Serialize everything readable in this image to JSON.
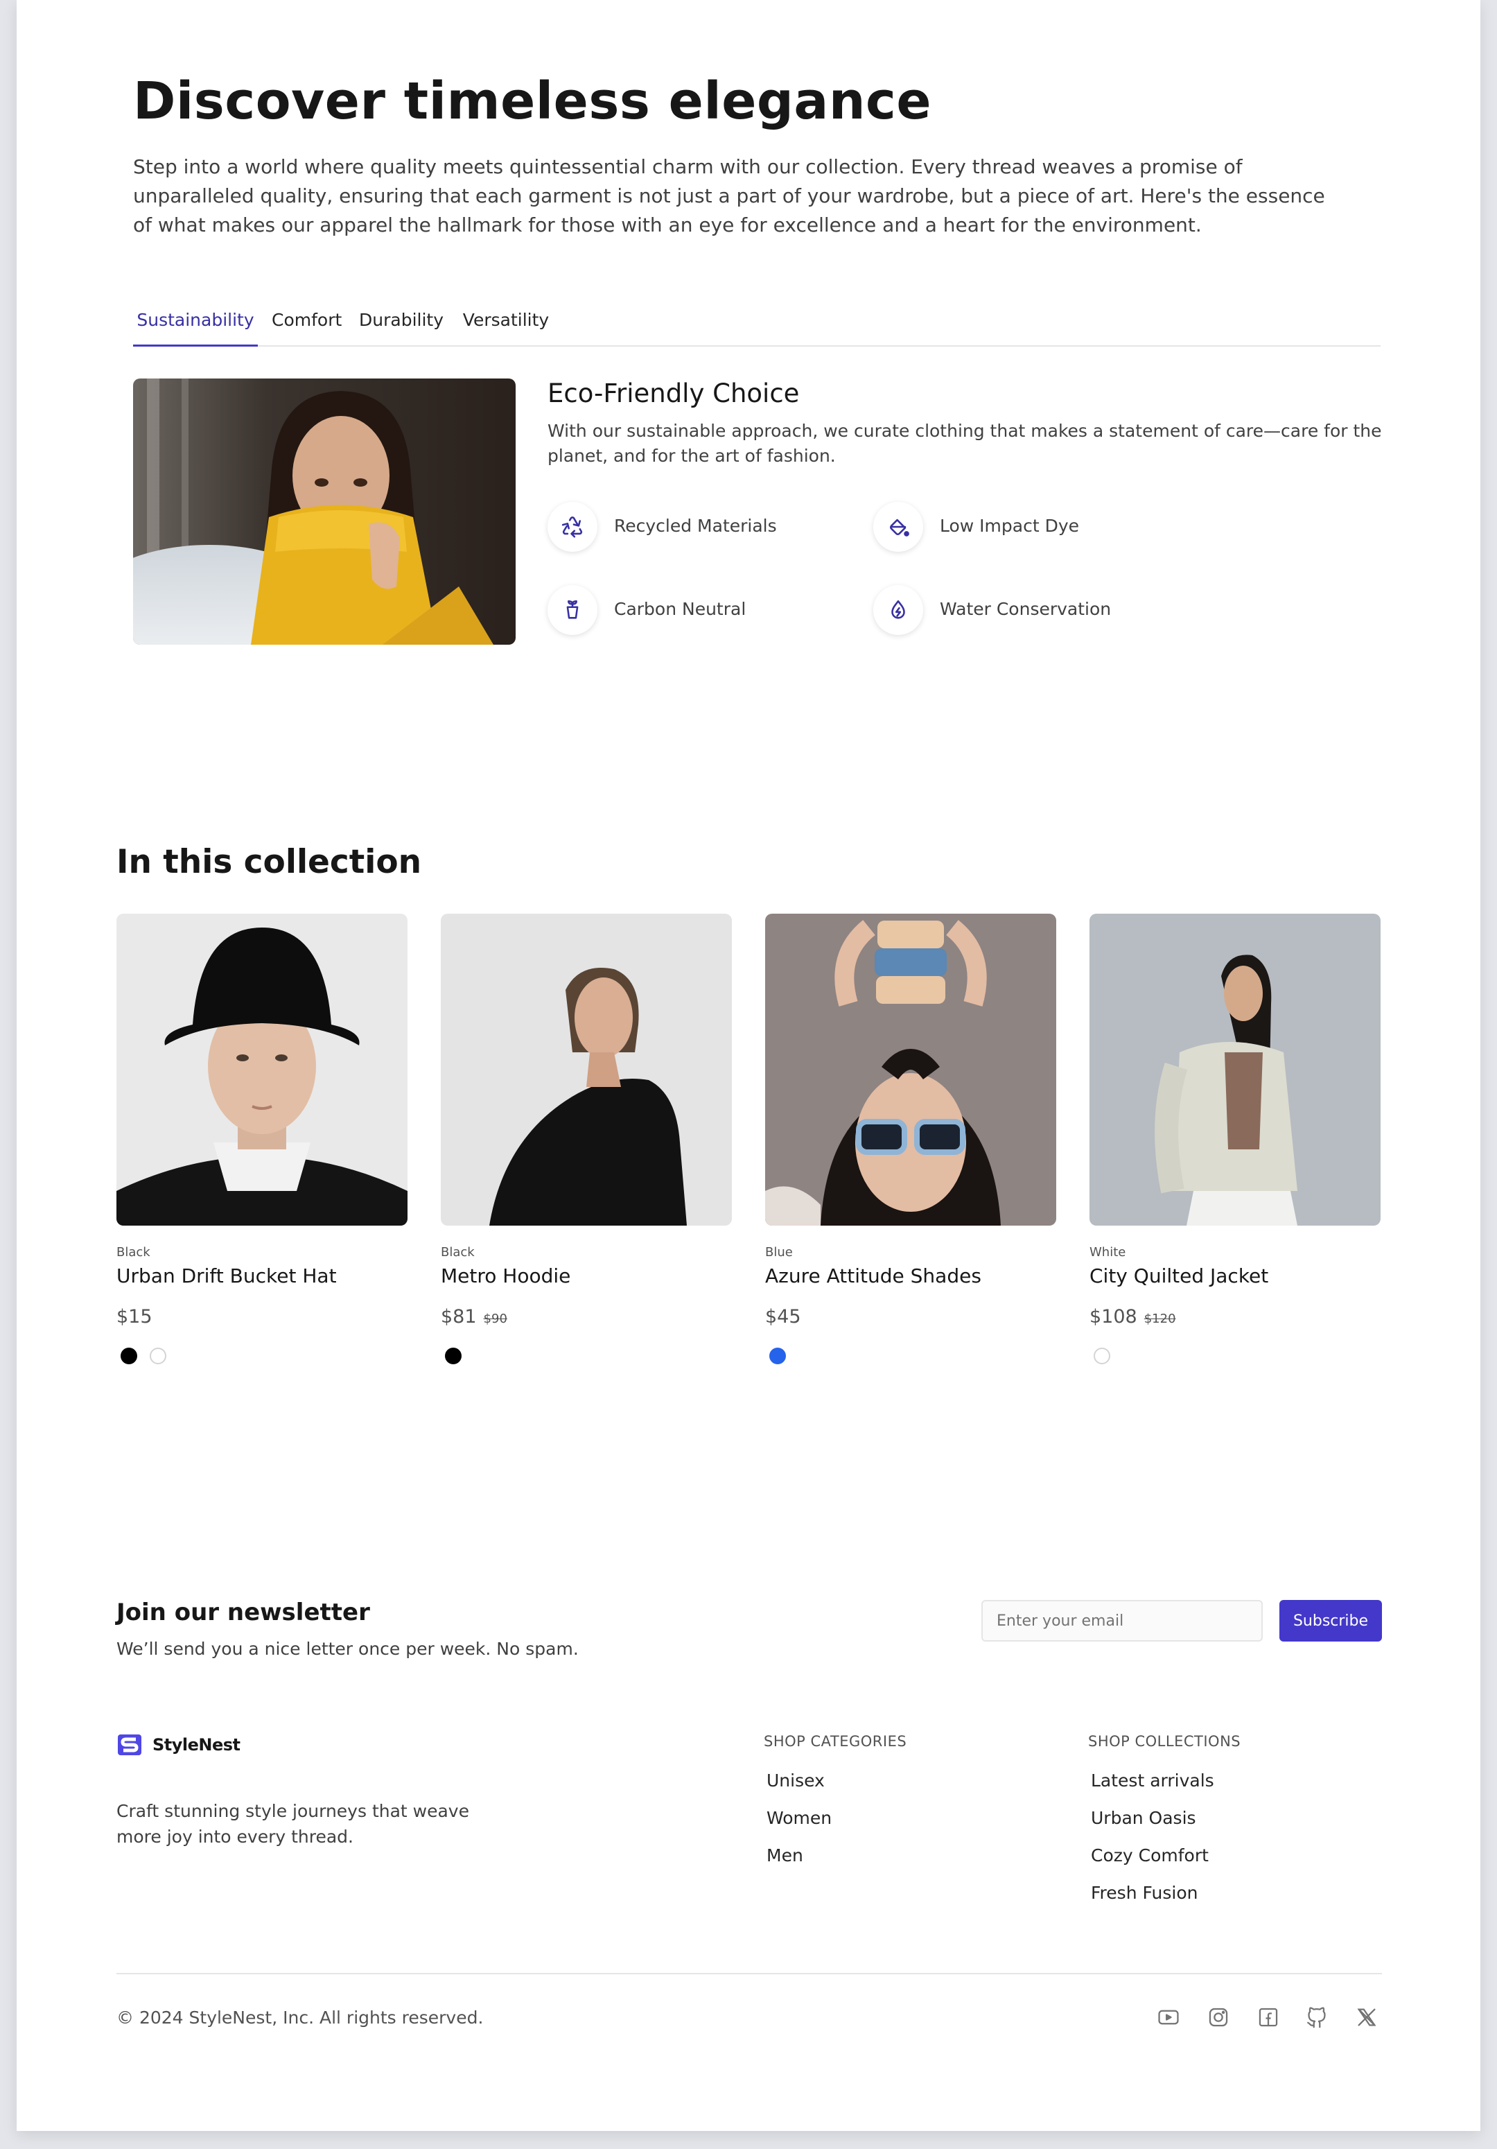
{
  "hero": {
    "title": "Discover timeless elegance",
    "description": "Step into a world where quality meets quintessential charm with our collection. Every thread weaves a promise of unparalleled quality, ensuring that each garment is not just a part of your wardrobe, but a piece of art. Here's the essence of what makes our apparel the hallmark for those with an eye for excellence and a heart for the environment."
  },
  "tabs": [
    {
      "label": "Sustainability",
      "active": true
    },
    {
      "label": "Comfort",
      "active": false
    },
    {
      "label": "Durability",
      "active": false
    },
    {
      "label": "Versatility",
      "active": false
    }
  ],
  "feature": {
    "title": "Eco-Friendly Choice",
    "description": "With our sustainable approach, we curate clothing that makes a statement of care—care for the planet, and for the art of fashion.",
    "items": [
      {
        "label": "Recycled Materials",
        "icon": "recycle-icon"
      },
      {
        "label": "Low Impact Dye",
        "icon": "paint-bucket-icon"
      },
      {
        "label": "Carbon Neutral",
        "icon": "plant-icon"
      },
      {
        "label": "Water Conservation",
        "icon": "water-drop-icon"
      }
    ]
  },
  "collection": {
    "title": "In this collection",
    "products": [
      {
        "color": "Black",
        "name": "Urban Drift Bucket Hat",
        "price": "$15",
        "old_price": "",
        "swatches": [
          "#000000",
          "#ffffff"
        ]
      },
      {
        "color": "Black",
        "name": "Metro Hoodie",
        "price": "$81",
        "old_price": "$90",
        "swatches": [
          "#000000"
        ]
      },
      {
        "color": "Blue",
        "name": "Azure Attitude Shades",
        "price": "$45",
        "old_price": "",
        "swatches": [
          "#2563eb"
        ]
      },
      {
        "color": "White",
        "name": "City Quilted Jacket",
        "price": "$108",
        "old_price": "$120",
        "swatches": [
          "#ffffff"
        ]
      }
    ]
  },
  "newsletter": {
    "title": "Join our newsletter",
    "subtitle": "We’ll send you a nice letter once per week. No spam.",
    "placeholder": "Enter your email",
    "button": "Subscribe"
  },
  "footer": {
    "brand": "StyleNest",
    "tagline": "Craft stunning style journeys that weave more joy into every thread.",
    "categories_heading": "SHOP CATEGORIES",
    "categories": [
      "Unisex",
      "Women",
      "Men"
    ],
    "collections_heading": "SHOP COLLECTIONS",
    "collections": [
      "Latest arrivals",
      "Urban Oasis",
      "Cozy Comfort",
      "Fresh Fusion"
    ],
    "copyright": "© 2024 StyleNest, Inc. All rights reserved.",
    "social": [
      "youtube-icon",
      "instagram-icon",
      "facebook-icon",
      "github-icon",
      "x-icon"
    ]
  },
  "colors": {
    "accent": "#4338ca",
    "accent_text": "#3730a3",
    "logo": "#4f46e5"
  }
}
